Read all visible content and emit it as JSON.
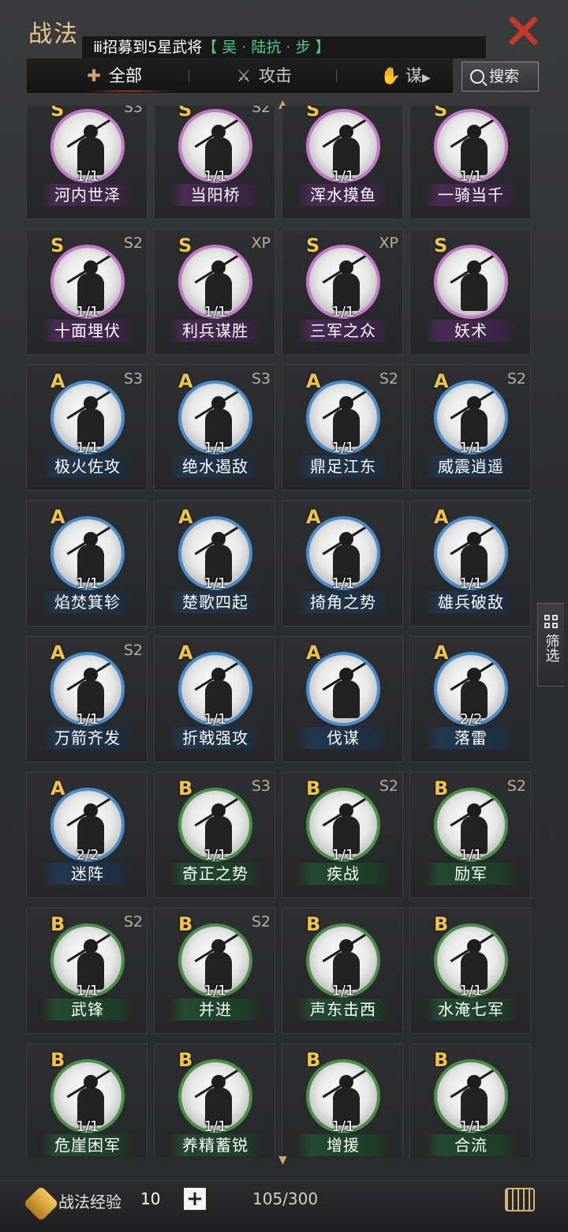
{
  "header": {
    "title": "战法",
    "ticker_prefix": "ⅲ招募到5星武将",
    "ticker_hero": "【 吴 · 陆抗 · 步 】"
  },
  "tabs": [
    {
      "label": "全部",
      "icon": "tally-icon",
      "active": true
    },
    {
      "label": "攻击",
      "icon": "crossed-swords-icon",
      "active": false
    },
    {
      "label": "谋",
      "icon": "fan-icon",
      "active": false
    }
  ],
  "search": {
    "label": "搜索"
  },
  "filter": {
    "label": "筛选"
  },
  "cards": [
    {
      "grade": "S",
      "slot": "S3",
      "count": "1/1",
      "name": "河内世泽"
    },
    {
      "grade": "S",
      "slot": "S2",
      "count": "1/1",
      "name": "当阳桥"
    },
    {
      "grade": "S",
      "slot": "",
      "count": "1/1",
      "name": "浑水摸鱼"
    },
    {
      "grade": "S",
      "slot": "",
      "count": "1/1",
      "name": "一骑当千"
    },
    {
      "grade": "S",
      "slot": "S2",
      "count": "1/1",
      "name": "十面埋伏"
    },
    {
      "grade": "S",
      "slot": "XP",
      "count": "1/1",
      "name": "利兵谋胜"
    },
    {
      "grade": "S",
      "slot": "XP",
      "count": "1/1",
      "name": "三军之众"
    },
    {
      "grade": "S",
      "slot": "",
      "count": "",
      "name": "妖术"
    },
    {
      "grade": "A",
      "slot": "S3",
      "count": "1/1",
      "name": "极火佐攻"
    },
    {
      "grade": "A",
      "slot": "S3",
      "count": "1/1",
      "name": "绝水遏敌"
    },
    {
      "grade": "A",
      "slot": "S2",
      "count": "1/1",
      "name": "鼎足江东"
    },
    {
      "grade": "A",
      "slot": "S2",
      "count": "1/1",
      "name": "威震逍遥"
    },
    {
      "grade": "A",
      "slot": "",
      "count": "1/1",
      "name": "焰焚箕轸"
    },
    {
      "grade": "A",
      "slot": "",
      "count": "1/1",
      "name": "楚歌四起"
    },
    {
      "grade": "A",
      "slot": "",
      "count": "1/1",
      "name": "掎角之势"
    },
    {
      "grade": "A",
      "slot": "",
      "count": "1/1",
      "name": "雄兵破敌"
    },
    {
      "grade": "A",
      "slot": "S2",
      "count": "1/1",
      "name": "万箭齐发"
    },
    {
      "grade": "A",
      "slot": "",
      "count": "1/1",
      "name": "折戟强攻"
    },
    {
      "grade": "A",
      "slot": "",
      "count": "",
      "name": "伐谋"
    },
    {
      "grade": "A",
      "slot": "",
      "count": "2/2",
      "name": "落雷"
    },
    {
      "grade": "A",
      "slot": "",
      "count": "2/2",
      "name": "迷阵"
    },
    {
      "grade": "B",
      "slot": "S3",
      "count": "1/1",
      "name": "奇正之势"
    },
    {
      "grade": "B",
      "slot": "S2",
      "count": "1/1",
      "name": "疾战"
    },
    {
      "grade": "B",
      "slot": "S2",
      "count": "1/1",
      "name": "励军"
    },
    {
      "grade": "B",
      "slot": "S2",
      "count": "1/1",
      "name": "武锋"
    },
    {
      "grade": "B",
      "slot": "S2",
      "count": "1/1",
      "name": "并进"
    },
    {
      "grade": "B",
      "slot": "",
      "count": "1/1",
      "name": "声东击西"
    },
    {
      "grade": "B",
      "slot": "",
      "count": "1/1",
      "name": "水淹七军"
    },
    {
      "grade": "B",
      "slot": "",
      "count": "1/1",
      "name": "危崖困军"
    },
    {
      "grade": "B",
      "slot": "",
      "count": "1/1",
      "name": "养精蓄锐"
    },
    {
      "grade": "B",
      "slot": "",
      "count": "1/1",
      "name": "增援"
    },
    {
      "grade": "B",
      "slot": "",
      "count": "1/1",
      "name": "合流"
    }
  ],
  "footer": {
    "exp_label": "战法经验",
    "exp_value": "10",
    "add_label": "+",
    "count_total": "105/300"
  },
  "colors": {
    "grade_S_ring": "#c479c9",
    "grade_A_ring": "#4b8ccc",
    "grade_B_ring": "#4c8f4a",
    "title": "#e9c98f",
    "ticker_hero": "#43d18a",
    "close": "#c23a2c"
  }
}
